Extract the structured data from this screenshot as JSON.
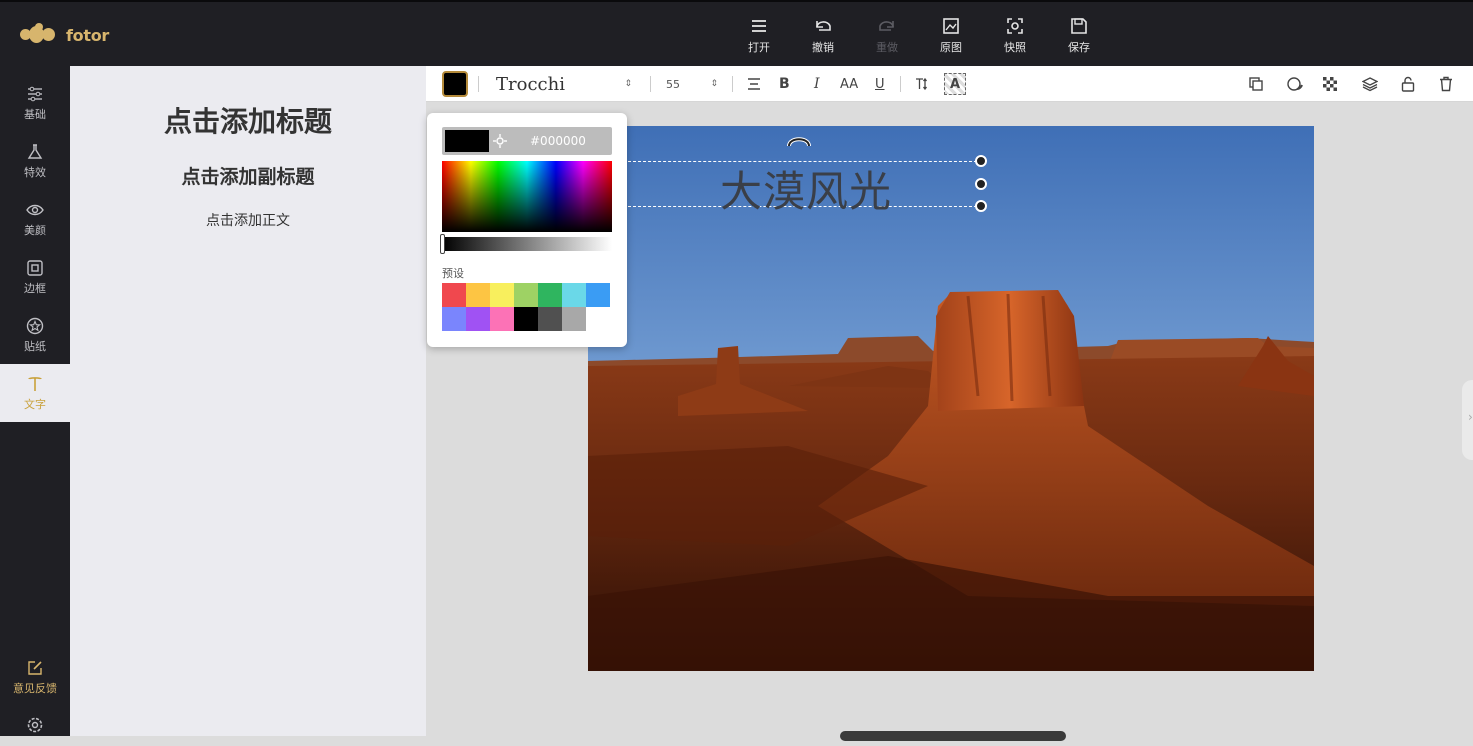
{
  "brand": {
    "name": "fotor"
  },
  "toolbar": {
    "items": [
      {
        "label": "打开",
        "icon": "menu-icon"
      },
      {
        "label": "撤销",
        "icon": "undo-icon"
      },
      {
        "label": "重做",
        "icon": "redo-icon",
        "disabled": true
      },
      {
        "label": "原图",
        "icon": "image-icon"
      },
      {
        "label": "快照",
        "icon": "snapshot-icon"
      },
      {
        "label": "保存",
        "icon": "save-icon"
      }
    ]
  },
  "sidebar": {
    "items": [
      {
        "label": "基础",
        "icon": "sliders-icon"
      },
      {
        "label": "特效",
        "icon": "flask-icon"
      },
      {
        "label": "美颜",
        "icon": "eye-icon"
      },
      {
        "label": "边框",
        "icon": "frame-icon"
      },
      {
        "label": "贴纸",
        "icon": "star-badge-icon"
      },
      {
        "label": "文字",
        "icon": "text-icon",
        "active": true
      }
    ],
    "feedback_label": "意见反馈"
  },
  "text_panel": {
    "title": "点击添加标题",
    "subtitle": "点击添加副标题",
    "body": "点击添加正文"
  },
  "text_toolbar": {
    "font_name": "Trocchi",
    "font_size": "55",
    "current_color": "#000000"
  },
  "color_picker": {
    "hex": "#000000",
    "preset_label": "预设",
    "presets": [
      "#f0484e",
      "#fdc543",
      "#f8ef5d",
      "#9ed264",
      "#2fb55f",
      "#6ad8e8",
      "#3a9cf4",
      "#7a85fd",
      "#a052f3",
      "#fc72b6",
      "#000000",
      "#505050",
      "#a8a8a8"
    ]
  },
  "canvas": {
    "text": "大漠风光"
  }
}
